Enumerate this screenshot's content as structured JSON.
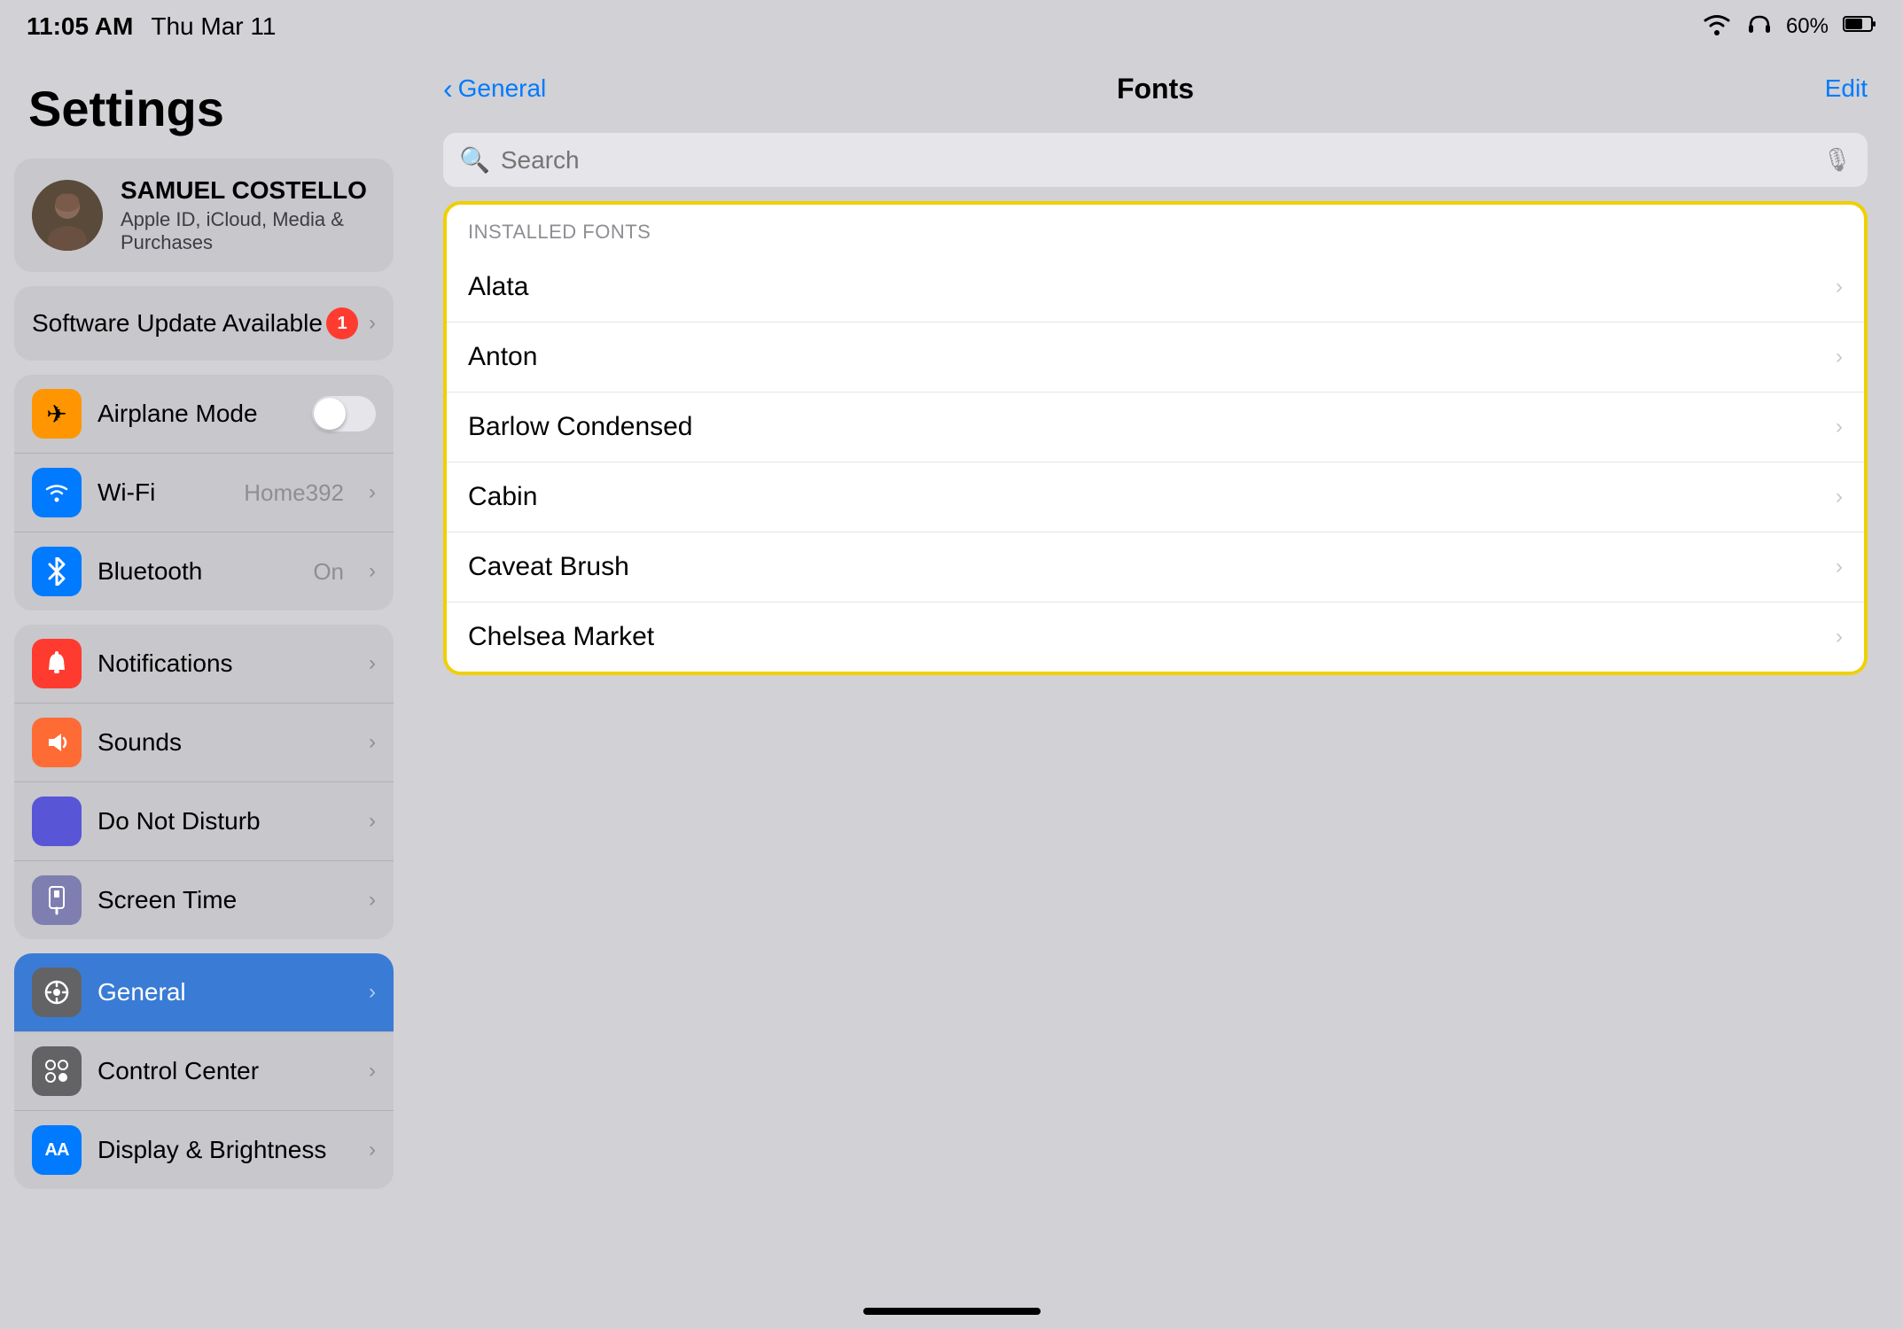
{
  "statusBar": {
    "time": "11:05 AM",
    "date": "Thu Mar 11",
    "wifi": "wifi",
    "headphones": "headphones",
    "battery": "60%"
  },
  "sidebar": {
    "title": "Settings",
    "profile": {
      "name": "SAMUEL COSTELLO",
      "subtitle": "Apple ID, iCloud, Media & Purchases"
    },
    "softwareUpdate": {
      "label": "Software Update Available",
      "badge": "1"
    },
    "group1": [
      {
        "id": "airplane-mode",
        "label": "Airplane Mode",
        "icon": "✈",
        "iconClass": "icon-orange",
        "hasToggle": true,
        "toggleOn": false
      },
      {
        "id": "wifi",
        "label": "Wi-Fi",
        "icon": "📶",
        "iconClass": "icon-blue",
        "value": "Home392",
        "hasToggle": false
      },
      {
        "id": "bluetooth",
        "label": "Bluetooth",
        "icon": "⬡",
        "iconClass": "icon-blue-light",
        "value": "On",
        "hasToggle": false
      }
    ],
    "group2": [
      {
        "id": "notifications",
        "label": "Notifications",
        "icon": "🔔",
        "iconClass": "icon-red"
      },
      {
        "id": "sounds",
        "label": "Sounds",
        "icon": "🔊",
        "iconClass": "icon-red-orange"
      },
      {
        "id": "do-not-disturb",
        "label": "Do Not Disturb",
        "icon": "🌙",
        "iconClass": "icon-purple"
      },
      {
        "id": "screen-time",
        "label": "Screen Time",
        "icon": "⌛",
        "iconClass": "icon-purple-dark"
      }
    ],
    "group3": [
      {
        "id": "general",
        "label": "General",
        "icon": "⚙",
        "iconClass": "icon-gray",
        "active": true
      },
      {
        "id": "control-center",
        "label": "Control Center",
        "icon": "◉",
        "iconClass": "icon-gray"
      },
      {
        "id": "display-brightness",
        "label": "Display & Brightness",
        "icon": "AA",
        "iconClass": "icon-aa"
      }
    ]
  },
  "fontsPanel": {
    "navBack": "General",
    "navTitle": "Fonts",
    "navEdit": "Edit",
    "searchPlaceholder": "Search",
    "sectionHeader": "INSTALLED FONTS",
    "fonts": [
      {
        "name": "Alata"
      },
      {
        "name": "Anton"
      },
      {
        "name": "Barlow Condensed"
      },
      {
        "name": "Cabin"
      },
      {
        "name": "Caveat Brush"
      },
      {
        "name": "Chelsea Market"
      }
    ]
  }
}
